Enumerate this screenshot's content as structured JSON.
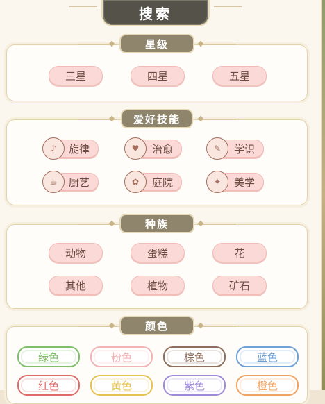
{
  "header": {
    "title": "搜索"
  },
  "star": {
    "title": "星级",
    "options": [
      "三星",
      "四星",
      "五星"
    ]
  },
  "hobby": {
    "title": "爱好技能",
    "options": [
      {
        "label": "旋律",
        "icon": "melody-icon"
      },
      {
        "label": "治愈",
        "icon": "healing-icon"
      },
      {
        "label": "学识",
        "icon": "knowledge-icon"
      },
      {
        "label": "厨艺",
        "icon": "cooking-icon"
      },
      {
        "label": "庭院",
        "icon": "garden-icon"
      },
      {
        "label": "美学",
        "icon": "aesthetics-icon"
      }
    ]
  },
  "race": {
    "title": "种族",
    "options": [
      "动物",
      "蛋糕",
      "花",
      "其他",
      "植物",
      "矿石"
    ]
  },
  "color": {
    "title": "颜色",
    "options": [
      {
        "label": "绿色",
        "color": "#7fbf6a"
      },
      {
        "label": "粉色",
        "color": "#f3b4b6"
      },
      {
        "label": "棕色",
        "color": "#8e6f5c"
      },
      {
        "label": "蓝色",
        "color": "#6fa0d6"
      },
      {
        "label": "红色",
        "color": "#e06a6a"
      },
      {
        "label": "黄色",
        "color": "#e5c34f"
      },
      {
        "label": "紫色",
        "color": "#9e8bd8"
      },
      {
        "label": "橙色",
        "color": "#f0a463"
      }
    ]
  }
}
